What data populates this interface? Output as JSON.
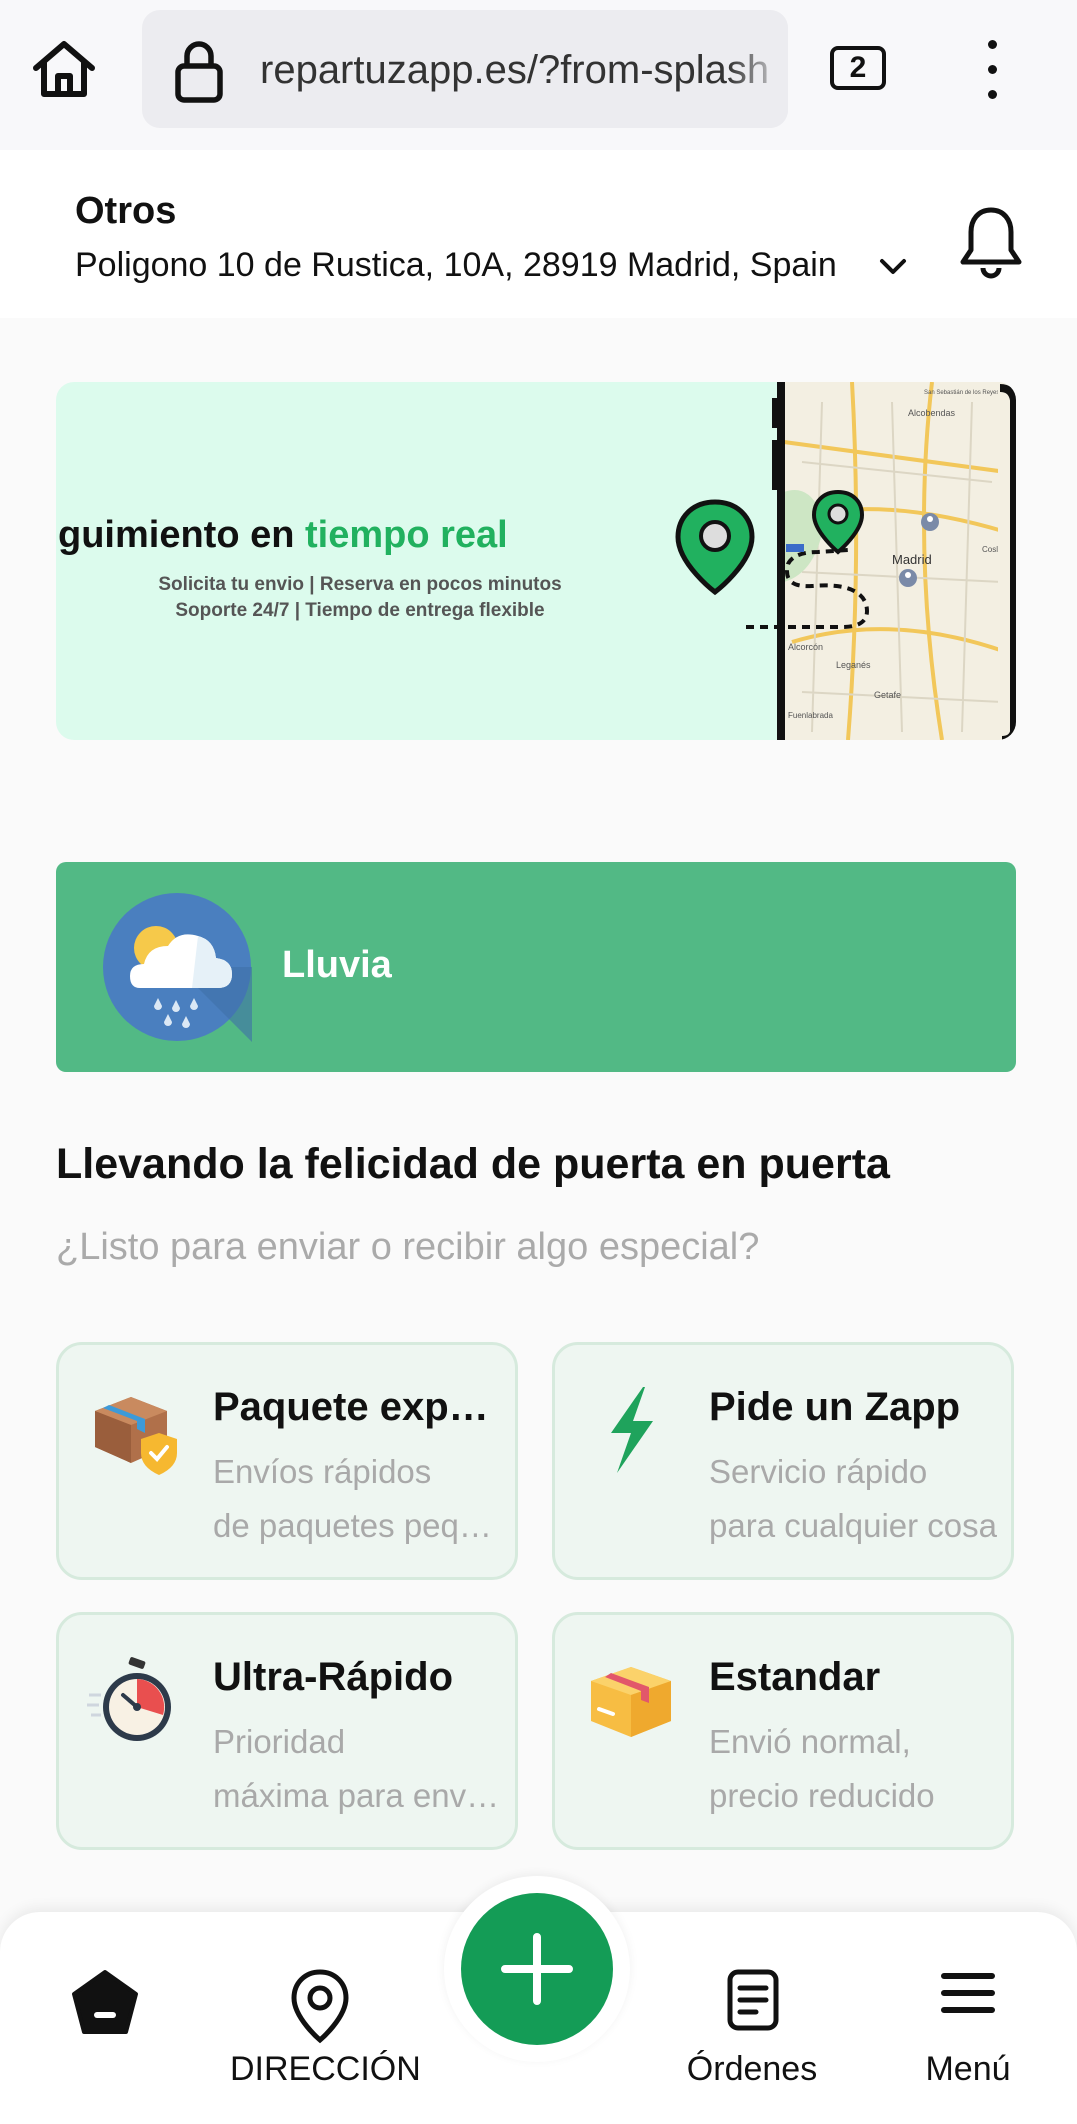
{
  "browser": {
    "url": "repartuzapp.es/?from-splash",
    "tab_count": "2"
  },
  "header": {
    "place_name": "Otros",
    "address": "Poligono 10 de Rustica, 10A, 28919 Madrid, Spain"
  },
  "banner": {
    "title_prefix": "guimiento en ",
    "title_highlight": "tiempo real",
    "line1": "Solicita tu envio | Reserva en pocos minutos",
    "line2": "Soporte 24/7 | Tiempo de entrega flexible",
    "map_labels": {
      "alcobendas": "Alcobendas",
      "madrid": "Madrid",
      "alcorcon": "Alcorcón",
      "leganes": "Leganés",
      "getafe": "Getafe",
      "fuenlabrada": "Fuenlabrada",
      "coslada": "Coslada",
      "sanse": "San Sebastián de los Reyes"
    },
    "accent_color": "#21b15f"
  },
  "weather": {
    "label": "Lluvia",
    "background_color": "#52b985"
  },
  "main": {
    "heading": "Llevando la felicidad de puerta en puerta",
    "subheading": "¿Listo para enviar o recibir algo especial?"
  },
  "services": [
    {
      "title": "Paquete express",
      "desc_line1": "Envíos rápidos",
      "desc_line2": "de paquetes pequeños",
      "icon": "package-shield-icon"
    },
    {
      "title": "Pide un Zapp",
      "desc_line1": "Servicio rápido",
      "desc_line2": "para cualquier cosa",
      "icon": "lightning-icon"
    },
    {
      "title": "Ultra-Rápido",
      "desc_line1": "Prioridad",
      "desc_line2": "máxima para envíos",
      "icon": "stopwatch-icon"
    },
    {
      "title": "Estandar",
      "desc_line1": "Envió normal,",
      "desc_line2": "precio reducido",
      "icon": "box-icon"
    }
  ],
  "nav": {
    "home_label": "",
    "address_label": "DIRECCIÓN",
    "orders_label": "Órdenes",
    "menu_label": "Menú",
    "fab_color": "#149c56"
  }
}
